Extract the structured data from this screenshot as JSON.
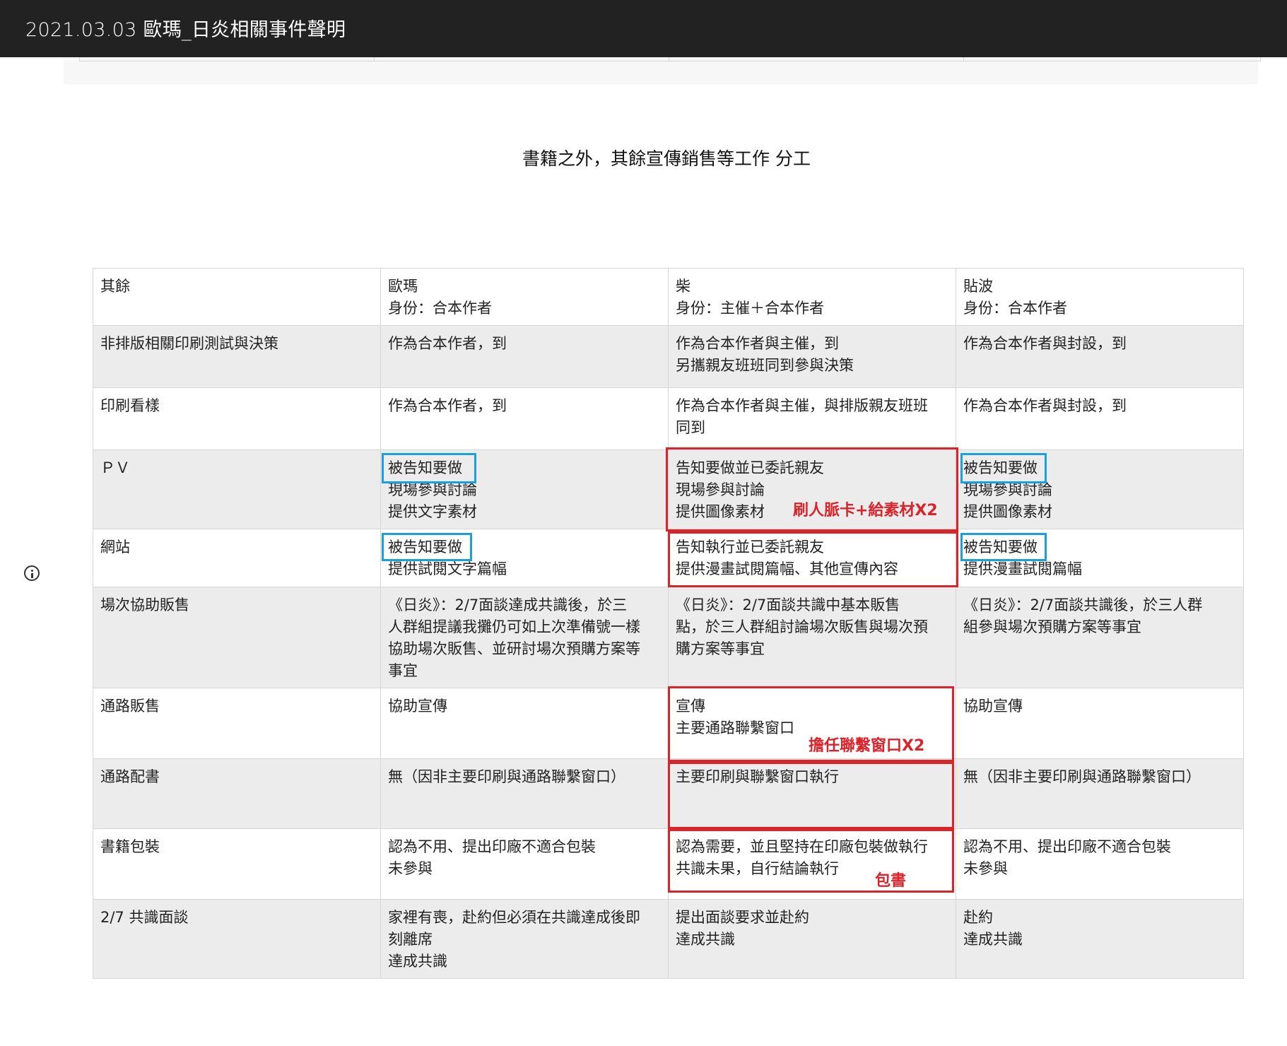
{
  "header": {
    "title": "2021.03.03 歐瑪_日炎相關事件聲明"
  },
  "heading": "書籍之外，其餘宣傳銷售等工作  分工",
  "table": {
    "columns": [
      "其餘",
      "歐瑪\n身份：合本作者",
      "柴\n身份：主催＋合本作者",
      "貼波\n身份：合本作者"
    ],
    "rows": [
      [
        "非排版相關印刷測試與決策",
        "作為合本作者，到",
        "作為合本作者與主催，到\n另攜親友班班同到參與決策",
        "作為合本作者與封設，到"
      ],
      [
        "印刷看樣",
        "作為合本作者，到",
        "作為合本作者與主催，與排版親友班班\n同到",
        "作為合本作者與封設，到"
      ],
      [
        "ＰＶ",
        "被告知要做\n現場參與討論\n提供文字素材",
        "告知要做並已委託親友\n現場參與討論\n提供圖像素材",
        "被告知要做\n現場參與討論\n提供圖像素材"
      ],
      [
        "網站",
        "被告知要做\n提供試閱文字篇幅",
        "告知執行並已委託親友\n提供漫畫試閱篇幅、其他宣傳內容",
        "被告知要做\n提供漫畫試閱篇幅"
      ],
      [
        "場次協助販售",
        "《日炎》：2/7面談達成共識後，於三\n人群組提議我攤仍可如上次準備號一樣\n協助場次販售、並研討場次預購方案等\n事宜",
        "《日炎》：2/7面談共識中基本販售\n點，於三人群組討論場次販售與場次預\n購方案等事宜",
        "《日炎》：2/7面談共識後，於三人群\n組參與場次預購方案等事宜"
      ],
      [
        "通路販售",
        "協助宣傳",
        "宣傳\n主要通路聯繫窗口",
        "協助宣傳"
      ],
      [
        "通路配書",
        "無（因非主要印刷與通路聯繫窗口）",
        "主要印刷與聯繫窗口執行",
        "無（因非主要印刷與通路聯繫窗口）"
      ],
      [
        "書籍包裝",
        "認為不用、提出印廠不適合包裝\n未參與",
        "認為需要，並且堅持在印廠包裝做執行\n共識未果，自行結論執行",
        "認為不用、提出印廠不適合包裝\n未參與"
      ],
      [
        "2/7 共識面談",
        "家裡有喪，赴約但必須在共識達成後即\n刻離席\n達成共識",
        "提出面談要求並赴約\n達成共識",
        "赴約\n達成共識"
      ]
    ]
  },
  "annotations": {
    "pv_note": "刷人脈卡+給素材X2",
    "channel_note": "擔任聯繫窗口X2",
    "package_note": "包書"
  },
  "colors": {
    "header_bg": "#222222",
    "highlight_blue": "#1aa0db",
    "highlight_red": "#d9242b",
    "row_gray": "#ececec"
  }
}
